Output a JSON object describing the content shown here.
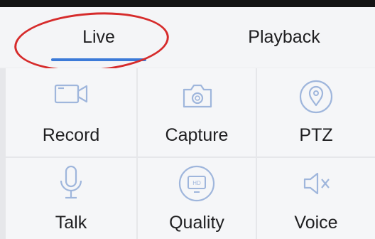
{
  "tabs": [
    {
      "label": "Live",
      "active": true
    },
    {
      "label": "Playback",
      "active": false
    }
  ],
  "colors": {
    "accent": "#3b7ad8",
    "icon": "#9fb6dc",
    "highlight": "#d62b2b"
  },
  "actions": [
    {
      "label": "Record",
      "icon": "video-camera-icon"
    },
    {
      "label": "Capture",
      "icon": "camera-icon"
    },
    {
      "label": "PTZ",
      "icon": "location-pin-icon"
    },
    {
      "label": "Talk",
      "icon": "microphone-icon"
    },
    {
      "label": "Quality",
      "icon": "hd-quality-icon"
    },
    {
      "label": "Voice",
      "icon": "speaker-muted-icon"
    }
  ]
}
